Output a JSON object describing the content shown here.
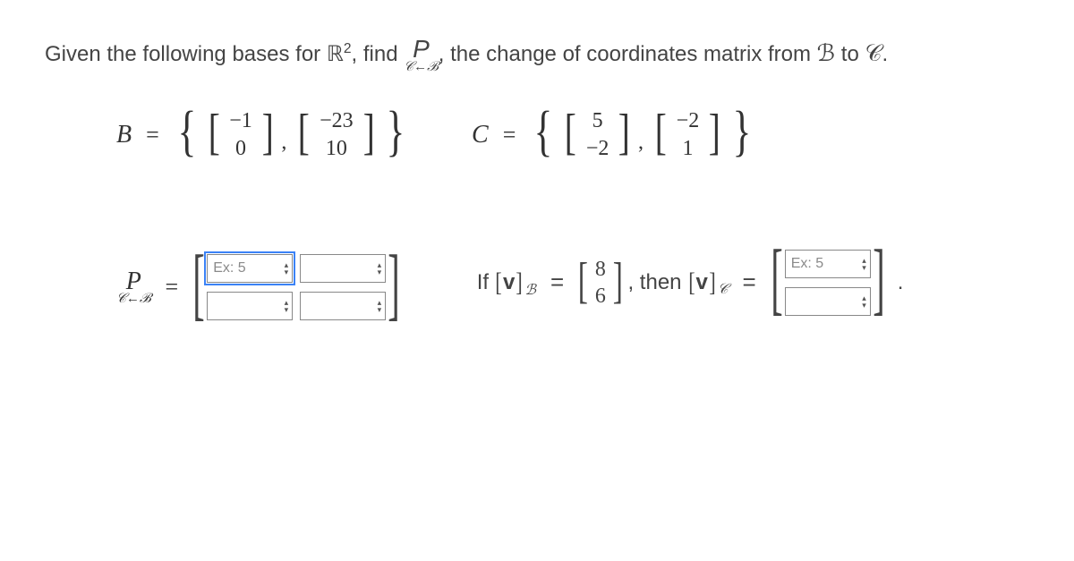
{
  "question": {
    "prefix": "Given the following bases for ",
    "space": "ℝ",
    "exponent": "2",
    "mid1": ", find ",
    "mid2": ", the change of coordinates matrix from ",
    "to": " to ",
    "end": "."
  },
  "symbols": {
    "P": "P",
    "cob_sub": "𝒞←ℬ",
    "B": "ℬ",
    "C": "𝒞",
    "B_plain": "B",
    "C_plain": "C",
    "eq": "=",
    "comma": ",",
    "period": ".",
    "then": ", then ",
    "If": "If ",
    "v": "v"
  },
  "basis_B": {
    "v1": [
      "−1",
      "0"
    ],
    "v2": [
      "−23",
      "10"
    ]
  },
  "basis_C": {
    "v1": [
      "5",
      "−2"
    ],
    "v2": [
      "−2",
      "1"
    ]
  },
  "P_matrix": {
    "rows": 2,
    "cols": 2,
    "placeholder": "Ex: 5",
    "highlight_cell": [
      0,
      0
    ]
  },
  "vB": [
    "8",
    "6"
  ],
  "vC_input": {
    "rows": 2,
    "placeholder": "Ex: 5"
  }
}
